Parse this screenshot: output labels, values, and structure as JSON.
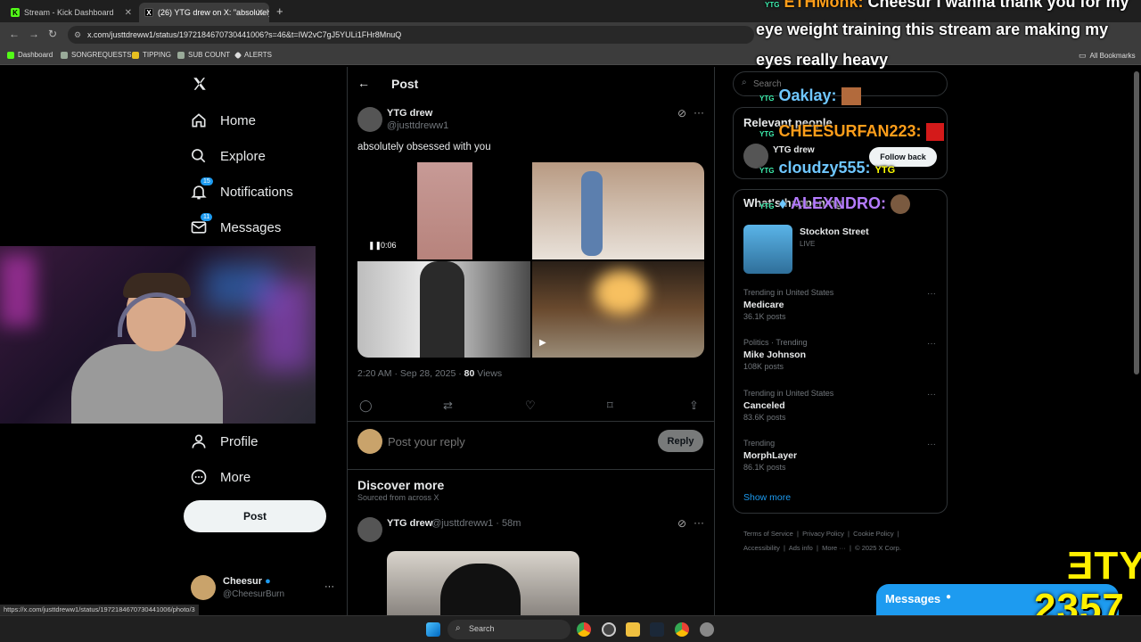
{
  "browser": {
    "tabs": [
      {
        "title": "Stream - Kick Dashboard",
        "active": false
      },
      {
        "title": "(26) YTG drew on X: \"absolutely",
        "active": true
      }
    ],
    "url": "x.com/justtdreww1/status/1972184670730441006?s=46&t=IW2vC7gJ5YULi1FHr8MnuQ",
    "bookmarks": [
      "Dashboard",
      "SONGREQUESTS",
      "TIPPING",
      "SUB COUNT",
      "ALERTS"
    ],
    "all_bookmarks": "All Bookmarks",
    "status_url": "https://x.com/justtdreww1/status/1972184670730441006/photo/3"
  },
  "nav": {
    "home": "Home",
    "explore": "Explore",
    "notifications": "Notifications",
    "notifications_badge": "15",
    "messages": "Messages",
    "messages_badge": "11",
    "profile": "Profile",
    "more": "More",
    "post_button": "Post",
    "account_name": "Cheesur",
    "account_handle": "@CheesurBurn"
  },
  "post": {
    "header": "Post",
    "author_name": "YTG drew",
    "author_handle": "@justtdreww1",
    "text": "absolutely obsessed with you",
    "video_time": "0:06",
    "timestamp": "2:20 AM · Sep 28, 2025 · ",
    "views": "80",
    "views_label": "Views",
    "reply_placeholder": "Post your reply",
    "reply_button": "Reply"
  },
  "discover": {
    "title": "Discover more",
    "subtitle": "Sourced from across X",
    "author_name": "YTG drew",
    "author_handle": "@justtdreww1 · 58m"
  },
  "sidebar": {
    "search_placeholder": "Search",
    "relevant_title": "Relevant people",
    "relevant_name": "YTG drew",
    "follow_back": "Follow back",
    "happening_title": "What's happening",
    "live_title": "Stockton Street",
    "live_label": "LIVE",
    "trends": [
      {
        "context": "Trending in United States",
        "name": "Medicare",
        "posts": "36.1K posts"
      },
      {
        "context": "Politics · Trending",
        "name": "Mike Johnson",
        "posts": "108K posts"
      },
      {
        "context": "Trending in United States",
        "name": "Canceled",
        "posts": "83.6K posts"
      },
      {
        "context": "Trending",
        "name": "MorphLayer",
        "posts": "86.1K posts"
      }
    ],
    "show_more": "Show more",
    "footer_links": [
      "Terms of Service",
      "Privacy Policy",
      "Cookie Policy",
      "Accessibility",
      "Ads info",
      "More ···",
      "© 2025 X Corp."
    ]
  },
  "messages_drawer": {
    "label": "Messages"
  },
  "overlay": {
    "chat": [
      {
        "name": "ETHMonk:",
        "text": "Cheesur I wanna thank you for my"
      },
      {
        "text": "eye weight training this stream are making my"
      },
      {
        "text": "eyes really heavy"
      },
      {
        "name": "Oaklay:"
      },
      {
        "name": "CHEESURFAN223:"
      },
      {
        "name": "cloudzy555:"
      },
      {
        "name": "ALEXNDRO:"
      }
    ],
    "badge": "YTG",
    "counter_top": "ƎTY",
    "counter": "2357"
  },
  "taskbar": {
    "search_placeholder": "Search"
  },
  "colors": {
    "accent": "#1d9bf0",
    "background": "#000000",
    "chat_orange": "#ff9e1a",
    "chat_purple": "#b57bff",
    "chat_blue": "#6fc7ff",
    "counter_yellow": "#fff000"
  }
}
